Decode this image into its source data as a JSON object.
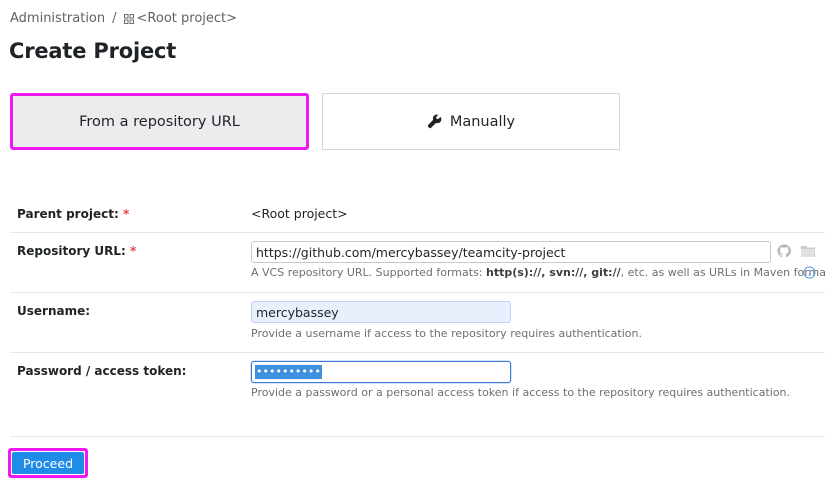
{
  "breadcrumb": {
    "admin": "Administration",
    "separator": "/",
    "root": "<Root project>"
  },
  "page": {
    "title": "Create Project"
  },
  "tabs": {
    "repo_url": "From a repository URL",
    "manual": "Manually"
  },
  "form": {
    "parent": {
      "label": "Parent project:",
      "required_mark": "*",
      "value": "<Root project>"
    },
    "repo": {
      "label": "Repository URL:",
      "required_mark": "*",
      "value": "https://github.com/mercybassey/teamcity-project",
      "help_prefix": "A VCS repository URL. Supported formats: ",
      "help_formats": "http(s)://, svn://, git://",
      "help_suffix": ", etc. as well as URLs in Maven format."
    },
    "username": {
      "label": "Username:",
      "value": "mercybassey",
      "help": "Provide a username if access to the repository requires authentication."
    },
    "password": {
      "label": "Password / access token:",
      "masked": "••••••••••",
      "help": "Provide a password or a personal access token if access to the repository requires authentication."
    }
  },
  "actions": {
    "proceed": "Proceed"
  },
  "colors": {
    "highlight": "#f018f0",
    "primary": "#1f8ce8",
    "required": "#e8424b"
  },
  "icons": [
    "grid-icon",
    "wrench-icon",
    "github-icon",
    "folder-icon",
    "help-circle-icon"
  ]
}
